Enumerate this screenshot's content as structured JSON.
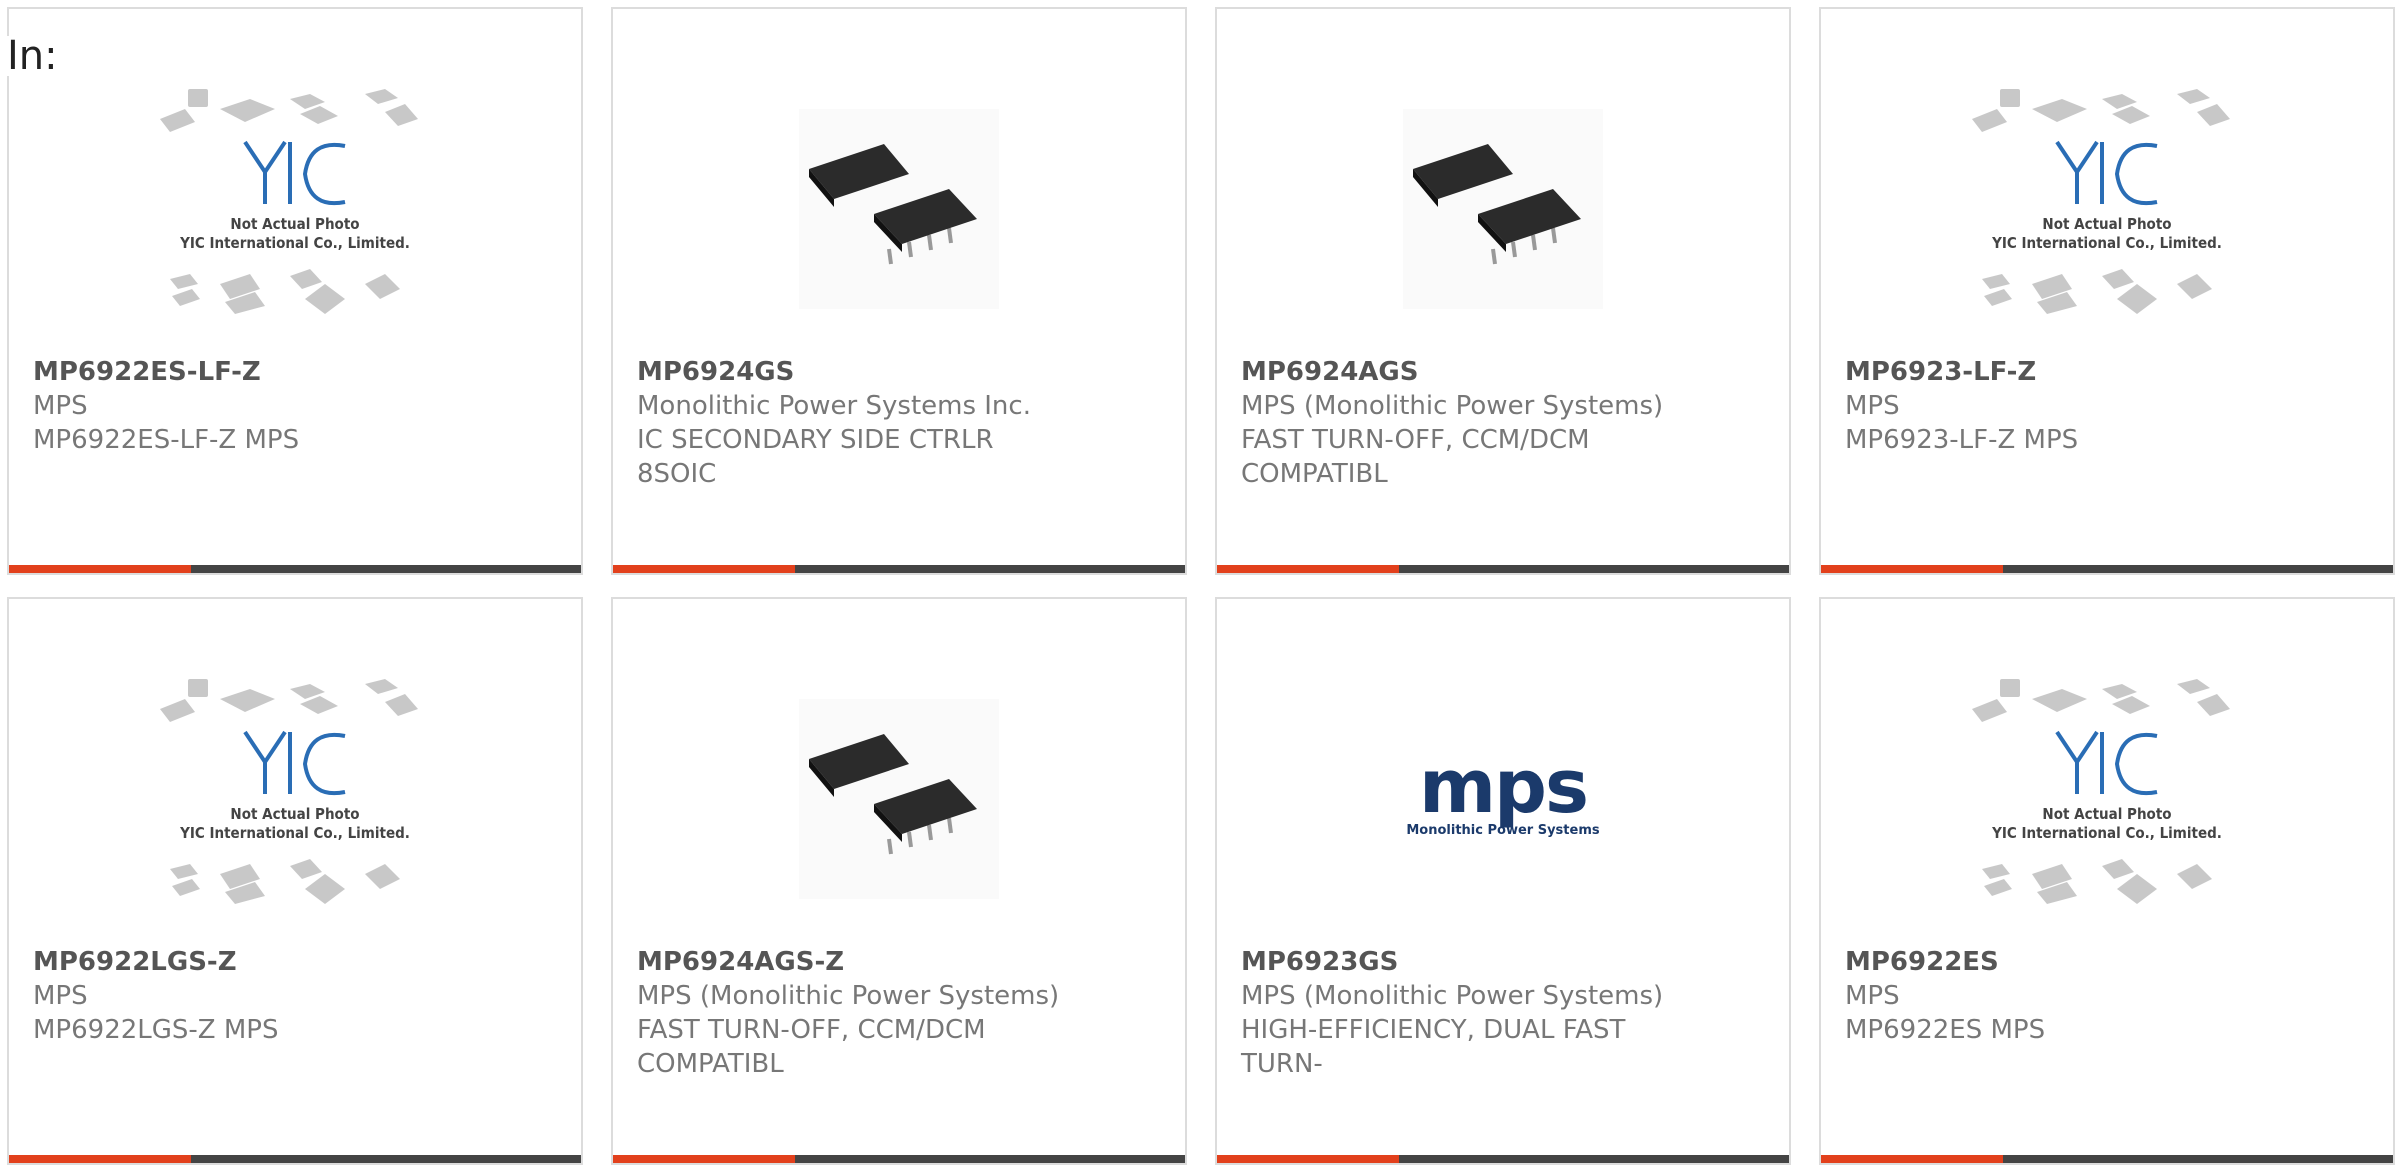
{
  "filter_label": "In:",
  "colors": {
    "accent": "#e2401c",
    "bar": "#444444",
    "mps_logo": "#1b3a6b"
  },
  "products": [
    {
      "part": "MP6922ES-LF-Z",
      "maker": "MPS",
      "desc": "MP6922ES-LF-Z MPS",
      "image": "yic-placeholder-icon"
    },
    {
      "part": "MP6924GS",
      "maker": "Monolithic Power Systems Inc.",
      "desc": "IC SECONDARY SIDE CTRLR 8SOIC",
      "image": "soic8-chip-icon"
    },
    {
      "part": "MP6924AGS",
      "maker": "MPS (Monolithic Power Systems)",
      "desc": "FAST TURN-OFF, CCM/DCM COMPATIBL",
      "image": "soic8-chip-icon"
    },
    {
      "part": "MP6923-LF-Z",
      "maker": "MPS",
      "desc": "MP6923-LF-Z MPS",
      "image": "yic-placeholder-icon"
    },
    {
      "part": "MP6922LGS-Z",
      "maker": "MPS",
      "desc": "MP6922LGS-Z MPS",
      "image": "yic-placeholder-icon"
    },
    {
      "part": "MP6924AGS-Z",
      "maker": "MPS (Monolithic Power Systems)",
      "desc": "FAST TURN-OFF, CCM/DCM COMPATIBL",
      "image": "soic8-chip-icon"
    },
    {
      "part": "MP6923GS",
      "maker": "MPS (Monolithic Power Systems)",
      "desc": "HIGH-EFFICIENCY, DUAL FAST TURN-",
      "image": "mps-logo-icon"
    },
    {
      "part": "MP6922ES",
      "maker": "MPS",
      "desc": "MP6922ES MPS",
      "image": "yic-placeholder-icon"
    }
  ],
  "placeholder": {
    "line1": "Not Actual Photo",
    "line2": "YIC International Co., Limited.",
    "brand": "YIC"
  },
  "mps_logo": {
    "wordmark": "mps",
    "tagline": "Monolithic Power Systems"
  }
}
